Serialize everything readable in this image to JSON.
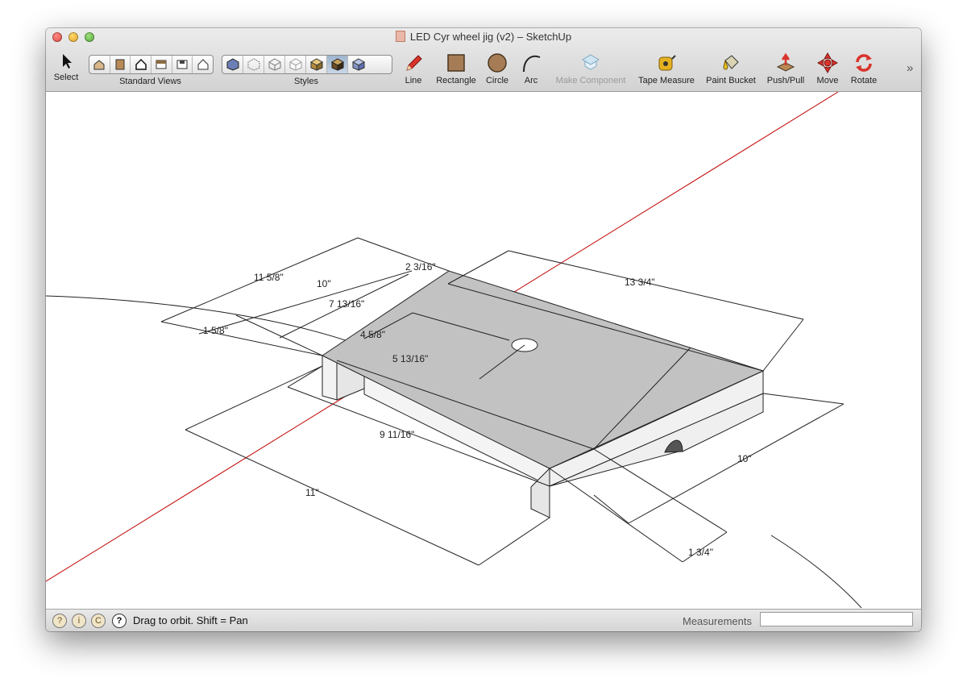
{
  "window": {
    "title": "LED Cyr wheel jig (v2) – SketchUp"
  },
  "toolbar": {
    "select": "Select",
    "standard_views": "Standard Views",
    "styles": "Styles",
    "line": "Line",
    "rectangle": "Rectangle",
    "circle": "Circle",
    "arc": "Arc",
    "make_component": "Make Component",
    "tape_measure": "Tape Measure",
    "paint_bucket": "Paint Bucket",
    "push_pull": "Push/Pull",
    "move": "Move",
    "rotate": "Rotate",
    "more": "»"
  },
  "dimensions": {
    "d1": "11 5/8\"",
    "d2": "10\"",
    "d3": "2 3/16\"",
    "d4": "13 3/4\"",
    "d5": "7 13/16\"",
    "d6": "1 5/8\"",
    "d7": "4 5/8\"",
    "d8": "5 13/16\"",
    "d9": "9 11/16\"",
    "d10": "10\"",
    "d11": "11\"",
    "d12": "1 3/4\""
  },
  "status": {
    "hint": "Drag to orbit.  Shift = Pan",
    "measurements_label": "Measurements",
    "measurements_value": ""
  },
  "colors": {
    "red_axis": "#c00000",
    "top_face": "#c2c2c2",
    "side_face": "#f2f2f2"
  }
}
